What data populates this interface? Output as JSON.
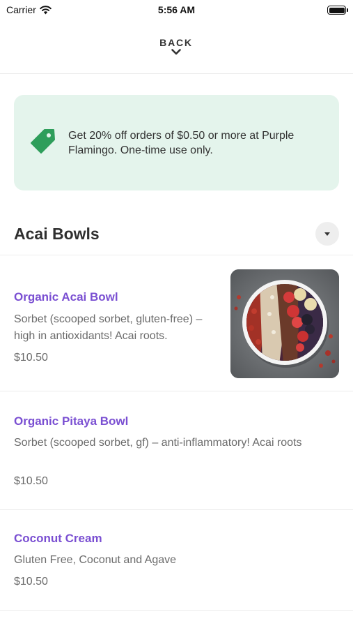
{
  "status_bar": {
    "carrier": "Carrier",
    "time": "5:56 AM",
    "wifi_icon": "wifi-icon",
    "battery_icon": "battery-icon"
  },
  "nav": {
    "back_label": "BACK",
    "back_icon": "chevron-down-icon"
  },
  "promo": {
    "icon": "tag-icon",
    "icon_color": "#2e9e5b",
    "background": "#e4f4ec",
    "text": "Get 20% off orders of $0.50 or more at Purple Flamingo. One-time use only."
  },
  "section": {
    "title": "Acai Bowls",
    "toggle_icon": "caret-down-icon"
  },
  "items": [
    {
      "name": "Organic Acai Bowl",
      "description": "Sorbet (scooped sorbet, gluten-free) – high in antioxidants! Acai roots.",
      "price": "$10.50",
      "image": "acai-bowl-photo"
    },
    {
      "name": "Organic Pitaya Bowl",
      "description": "Sorbet (scooped sorbet, gf) – anti-inflammatory! Acai roots",
      "price": "$10.50"
    },
    {
      "name": "Coconut Cream",
      "description": "Gluten Free, Coconut and Agave",
      "price": "$10.50"
    }
  ],
  "colors": {
    "item_name": "#7a4fd2",
    "promo_background": "#e4f4ec",
    "tag_icon": "#2e9e5b"
  }
}
